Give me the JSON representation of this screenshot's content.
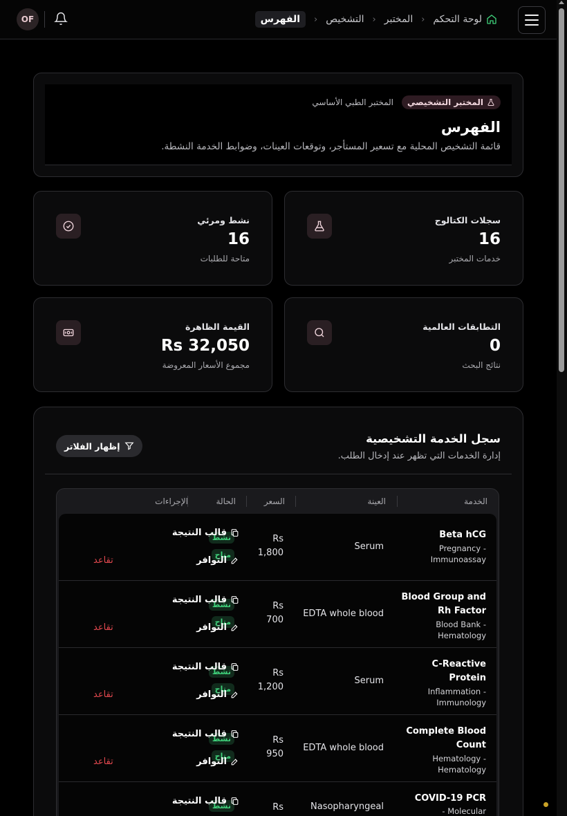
{
  "topbar": {
    "avatar_initials": "OF",
    "breadcrumbs": [
      "لوحة التحكم",
      "المختبر",
      "التشخيص",
      "الفهرس"
    ]
  },
  "hero": {
    "badge_primary": "المختبر التشخيصي",
    "badge_secondary": "المختبر الطبي الأساسي",
    "title": "الفهرس",
    "description": "قائمة التشخيص المحلية مع تسعير المستأجر، وتوقعات العينات، وضوابط الخدمة النشطة."
  },
  "stats": [
    {
      "label": "سجلات الكتالوج",
      "value": "16",
      "sub": "خدمات المختبر",
      "icon": "flask-icon"
    },
    {
      "label": "نشط ومرئي",
      "value": "16",
      "sub": "متاحة للطلبات",
      "icon": "check-circle-icon"
    },
    {
      "label": "التطابقات العالمية",
      "value": "0",
      "sub": "نتائج البحث",
      "icon": "search-icon"
    },
    {
      "label": "القيمة الظاهرة",
      "value": "Rs 32,050",
      "sub": "مجموع الأسعار المعروضة",
      "icon": "banknote-icon"
    }
  ],
  "registry": {
    "title": "سجل الخدمة التشخيصية",
    "description": "إدارة الخدمات التي تظهر عند إدخال الطلب.",
    "filter_button": "إظهار الفلاتر",
    "columns": [
      "الخدمة",
      "العينة",
      "السعر",
      "الحالة",
      "الإجراءات"
    ],
    "action_template": "قالب النتيجة",
    "action_availability": "التوافر",
    "action_retire": "تقاعد",
    "rows": [
      {
        "name": "Beta hCG",
        "category": "Pregnancy - Immunoassay",
        "sample": "Serum",
        "price_currency": "Rs",
        "price": "1,800",
        "status": "نشط",
        "availability": "متاح"
      },
      {
        "name": "Blood Group and Rh Factor",
        "category": "Blood Bank - Hematology",
        "sample": "EDTA whole blood",
        "price_currency": "Rs",
        "price": "700",
        "status": "نشط",
        "availability": "متاح"
      },
      {
        "name": "C-Reactive Protein",
        "category": "Inflammation - Immunology",
        "sample": "Serum",
        "price_currency": "Rs",
        "price": "1,200",
        "status": "نشط",
        "availability": "متاح"
      },
      {
        "name": "Complete Blood Count",
        "category": "Hematology - Hematology",
        "sample": "EDTA whole blood",
        "price_currency": "Rs",
        "price": "950",
        "status": "نشط",
        "availability": "متاح"
      },
      {
        "name": "COVID-19 PCR",
        "category": "Molecular -",
        "sample": "Nasopharyngeal",
        "price_currency": "Rs",
        "price": "",
        "status": "نشط",
        "availability": ""
      }
    ]
  },
  "colors": {
    "background": "#000000",
    "card": "#0b0b0c",
    "accent_pink": "#2e1b22",
    "status_green": "#3fd07a",
    "danger_red": "#e0484e"
  }
}
